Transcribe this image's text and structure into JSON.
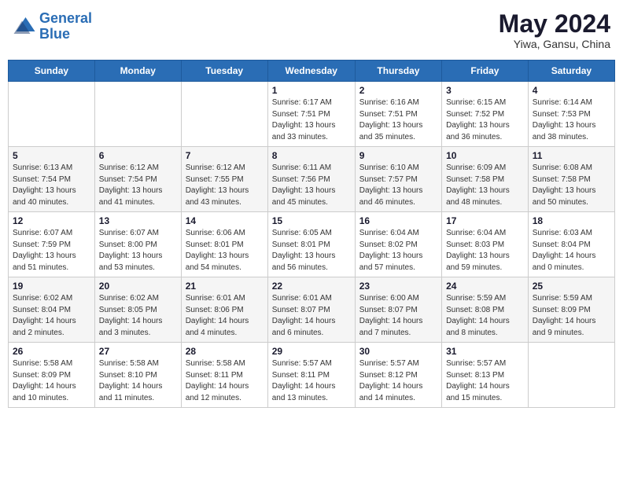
{
  "header": {
    "logo_line1": "General",
    "logo_line2": "Blue",
    "month_year": "May 2024",
    "location": "Yiwa, Gansu, China"
  },
  "weekdays": [
    "Sunday",
    "Monday",
    "Tuesday",
    "Wednesday",
    "Thursday",
    "Friday",
    "Saturday"
  ],
  "weeks": [
    [
      {
        "day": "",
        "info": ""
      },
      {
        "day": "",
        "info": ""
      },
      {
        "day": "",
        "info": ""
      },
      {
        "day": "1",
        "info": "Sunrise: 6:17 AM\nSunset: 7:51 PM\nDaylight: 13 hours\nand 33 minutes."
      },
      {
        "day": "2",
        "info": "Sunrise: 6:16 AM\nSunset: 7:51 PM\nDaylight: 13 hours\nand 35 minutes."
      },
      {
        "day": "3",
        "info": "Sunrise: 6:15 AM\nSunset: 7:52 PM\nDaylight: 13 hours\nand 36 minutes."
      },
      {
        "day": "4",
        "info": "Sunrise: 6:14 AM\nSunset: 7:53 PM\nDaylight: 13 hours\nand 38 minutes."
      }
    ],
    [
      {
        "day": "5",
        "info": "Sunrise: 6:13 AM\nSunset: 7:54 PM\nDaylight: 13 hours\nand 40 minutes."
      },
      {
        "day": "6",
        "info": "Sunrise: 6:12 AM\nSunset: 7:54 PM\nDaylight: 13 hours\nand 41 minutes."
      },
      {
        "day": "7",
        "info": "Sunrise: 6:12 AM\nSunset: 7:55 PM\nDaylight: 13 hours\nand 43 minutes."
      },
      {
        "day": "8",
        "info": "Sunrise: 6:11 AM\nSunset: 7:56 PM\nDaylight: 13 hours\nand 45 minutes."
      },
      {
        "day": "9",
        "info": "Sunrise: 6:10 AM\nSunset: 7:57 PM\nDaylight: 13 hours\nand 46 minutes."
      },
      {
        "day": "10",
        "info": "Sunrise: 6:09 AM\nSunset: 7:58 PM\nDaylight: 13 hours\nand 48 minutes."
      },
      {
        "day": "11",
        "info": "Sunrise: 6:08 AM\nSunset: 7:58 PM\nDaylight: 13 hours\nand 50 minutes."
      }
    ],
    [
      {
        "day": "12",
        "info": "Sunrise: 6:07 AM\nSunset: 7:59 PM\nDaylight: 13 hours\nand 51 minutes."
      },
      {
        "day": "13",
        "info": "Sunrise: 6:07 AM\nSunset: 8:00 PM\nDaylight: 13 hours\nand 53 minutes."
      },
      {
        "day": "14",
        "info": "Sunrise: 6:06 AM\nSunset: 8:01 PM\nDaylight: 13 hours\nand 54 minutes."
      },
      {
        "day": "15",
        "info": "Sunrise: 6:05 AM\nSunset: 8:01 PM\nDaylight: 13 hours\nand 56 minutes."
      },
      {
        "day": "16",
        "info": "Sunrise: 6:04 AM\nSunset: 8:02 PM\nDaylight: 13 hours\nand 57 minutes."
      },
      {
        "day": "17",
        "info": "Sunrise: 6:04 AM\nSunset: 8:03 PM\nDaylight: 13 hours\nand 59 minutes."
      },
      {
        "day": "18",
        "info": "Sunrise: 6:03 AM\nSunset: 8:04 PM\nDaylight: 14 hours\nand 0 minutes."
      }
    ],
    [
      {
        "day": "19",
        "info": "Sunrise: 6:02 AM\nSunset: 8:04 PM\nDaylight: 14 hours\nand 2 minutes."
      },
      {
        "day": "20",
        "info": "Sunrise: 6:02 AM\nSunset: 8:05 PM\nDaylight: 14 hours\nand 3 minutes."
      },
      {
        "day": "21",
        "info": "Sunrise: 6:01 AM\nSunset: 8:06 PM\nDaylight: 14 hours\nand 4 minutes."
      },
      {
        "day": "22",
        "info": "Sunrise: 6:01 AM\nSunset: 8:07 PM\nDaylight: 14 hours\nand 6 minutes."
      },
      {
        "day": "23",
        "info": "Sunrise: 6:00 AM\nSunset: 8:07 PM\nDaylight: 14 hours\nand 7 minutes."
      },
      {
        "day": "24",
        "info": "Sunrise: 5:59 AM\nSunset: 8:08 PM\nDaylight: 14 hours\nand 8 minutes."
      },
      {
        "day": "25",
        "info": "Sunrise: 5:59 AM\nSunset: 8:09 PM\nDaylight: 14 hours\nand 9 minutes."
      }
    ],
    [
      {
        "day": "26",
        "info": "Sunrise: 5:58 AM\nSunset: 8:09 PM\nDaylight: 14 hours\nand 10 minutes."
      },
      {
        "day": "27",
        "info": "Sunrise: 5:58 AM\nSunset: 8:10 PM\nDaylight: 14 hours\nand 11 minutes."
      },
      {
        "day": "28",
        "info": "Sunrise: 5:58 AM\nSunset: 8:11 PM\nDaylight: 14 hours\nand 12 minutes."
      },
      {
        "day": "29",
        "info": "Sunrise: 5:57 AM\nSunset: 8:11 PM\nDaylight: 14 hours\nand 13 minutes."
      },
      {
        "day": "30",
        "info": "Sunrise: 5:57 AM\nSunset: 8:12 PM\nDaylight: 14 hours\nand 14 minutes."
      },
      {
        "day": "31",
        "info": "Sunrise: 5:57 AM\nSunset: 8:13 PM\nDaylight: 14 hours\nand 15 minutes."
      },
      {
        "day": "",
        "info": ""
      }
    ]
  ]
}
